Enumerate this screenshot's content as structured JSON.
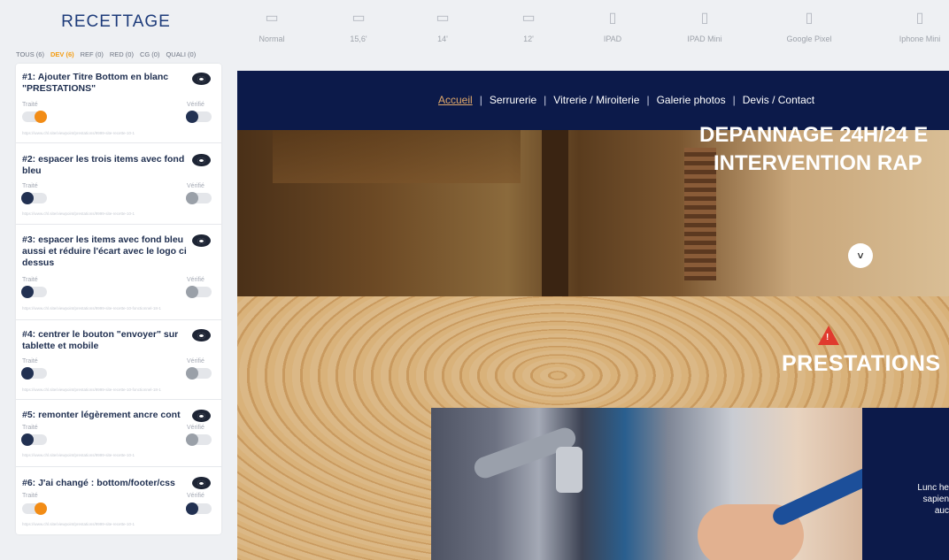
{
  "sidebar": {
    "title": "RECETTAGE",
    "filters": [
      "TOUS (6)",
      "DEV (6)",
      "REF (0)",
      "RED (0)",
      "CG (0)",
      "QUALI (0)"
    ],
    "active_filter": "DEV (6)",
    "cards": [
      {
        "title": "#1: Ajouter Titre Bottom en blanc \"PRESTATIONS\"",
        "traite_label": "Traité",
        "verifie_label": "Vérifié",
        "traite": true,
        "verifie": false,
        "url": "https://www.chl.site/viewpoint/prestations/9999-site-recette-10-1"
      },
      {
        "title": "#2: espacer les trois items avec fond bleu",
        "traite_label": "Traité",
        "verifie_label": "Vérifié",
        "traite": false,
        "verifie": false,
        "url": "https://www.chl.site/viewpoint/prestations/9999-site-recette-10-1"
      },
      {
        "title": "#3: espacer les items avec fond bleu aussi et réduire l'écart avec le logo ci dessus",
        "traite_label": "Traité",
        "verifie_label": "Vérifié",
        "traite": false,
        "verifie": false,
        "url": "https://www.chl.site/viewpoint/prestations/9999-site-recette-10-fonctionnel-18-1"
      },
      {
        "title": "#4: centrer le bouton \"envoyer\" sur tablette et mobile",
        "traite_label": "Traité",
        "verifie_label": "Vérifié",
        "traite": false,
        "verifie": false,
        "url": "https://www.chl.site/viewpoint/prestations/9999-site-recette-10-fonctionnel-18-1"
      },
      {
        "title": "#5: remonter légèrement ancre cont",
        "traite_label": "Traité",
        "verifie_label": "Vérifié",
        "traite": false,
        "verifie": false,
        "url": "https://www.chl.site/viewpoint/prestations/9999-site-recette-10-1"
      },
      {
        "title": "#6: J'ai changé : bottom/footer/css",
        "traite_label": "Traité",
        "verifie_label": "Vérifié",
        "traite": true,
        "verifie": false,
        "url": "https://www.chl.site/viewpoint/prestations/9999-site-recette-10-1"
      }
    ]
  },
  "devices": [
    {
      "label": "Normal",
      "icon": "desktop-icon"
    },
    {
      "label": "15,6'",
      "icon": "laptop-icon"
    },
    {
      "label": "14'",
      "icon": "laptop-icon"
    },
    {
      "label": "12'",
      "icon": "laptop-icon"
    },
    {
      "label": "IPAD",
      "icon": "tablet-icon"
    },
    {
      "label": "IPAD Mini",
      "icon": "tablet-icon"
    },
    {
      "label": "Google Pixel",
      "icon": "phone-icon"
    },
    {
      "label": "Iphone Mini",
      "icon": "phone-icon"
    }
  ],
  "preview": {
    "nav": [
      "Accueil",
      "Serrurerie",
      "Vitrerie / Miroiterie",
      "Galerie photos",
      "Devis / Contact"
    ],
    "hero_line1": "DEPANNAGE 24H/24 E",
    "hero_line2": "INTERVENTION RAP",
    "section_title": "PRESTATIONS",
    "blue_text": [
      "Lunc he",
      "sapien",
      "auc"
    ]
  },
  "colors": {
    "accent": "#f28c16",
    "navy": "#0c1a4a",
    "title_blue": "#1d3b7a",
    "alert_red": "#e03b2e"
  }
}
